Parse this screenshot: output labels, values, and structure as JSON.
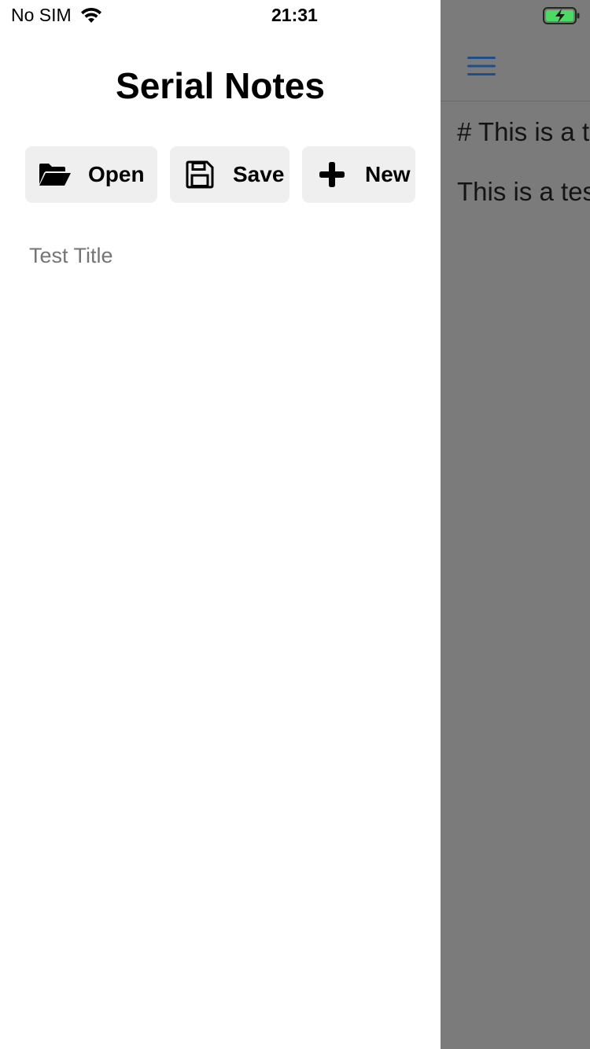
{
  "status_bar": {
    "carrier": "No SIM",
    "time": "21:31",
    "icons": [
      "wifi-icon",
      "battery-charging-icon"
    ]
  },
  "drawer": {
    "title": "Serial Notes",
    "buttons": [
      {
        "label": "Open",
        "icon": "folder-open-icon"
      },
      {
        "label": "Save",
        "icon": "floppy-disk-icon"
      },
      {
        "label": "New",
        "icon": "plus-icon"
      }
    ],
    "notes": [
      {
        "title": "Test Title"
      }
    ]
  },
  "editor": {
    "menu_icon": "hamburger-menu-icon",
    "lines": [
      "# This is a t",
      "This is a tes"
    ]
  },
  "colors": {
    "overlay": "#7b7b7b",
    "menu_accent": "#1f4e8c",
    "battery_green": "#4cd964",
    "button_bg": "#efefef",
    "note_title": "#757575"
  }
}
